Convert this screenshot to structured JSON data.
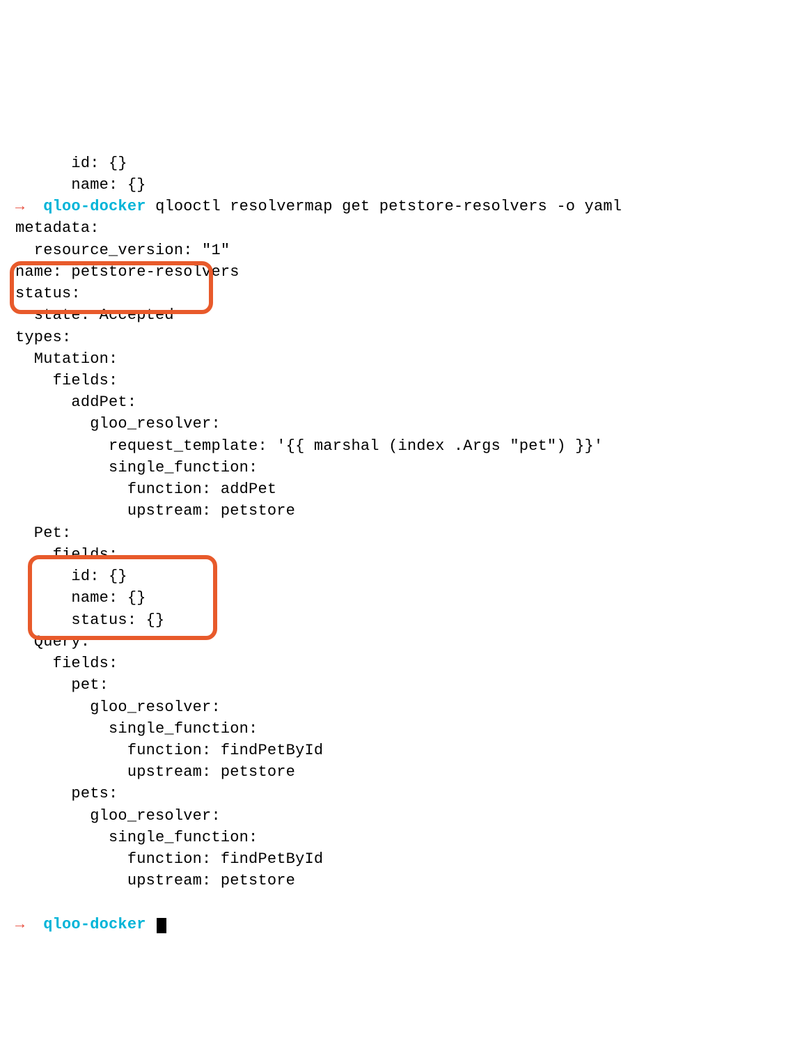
{
  "prompt": {
    "arrow": "→",
    "dir": "qloo-docker",
    "command": "qlooctl resolvermap get petstore-resolvers -o yaml"
  },
  "prompt2": {
    "arrow": "→",
    "dir": "qloo-docker"
  },
  "preamble": {
    "l1": "      id: {}",
    "l2": "      name: {}"
  },
  "output": {
    "l01": "metadata:",
    "l02": "  resource_version: \"1\"",
    "l03": "name: petstore-resolvers",
    "l04": "status:",
    "l05": "  state: Accepted",
    "l06": "types:",
    "l07": "  Mutation:",
    "l08": "    fields:",
    "l09": "      addPet:",
    "l10": "        gloo_resolver:",
    "l11": "          request_template: '{{ marshal (index .Args \"pet\") }}'",
    "l12": "          single_function:",
    "l13": "            function: addPet",
    "l14": "            upstream: petstore",
    "l15": "  Pet:",
    "l16": "    fields:",
    "l17": "      id: {}",
    "l18": "      name: {}",
    "l19": "      status: {}",
    "l20": "  Query:",
    "l21": "    fields:",
    "l22": "      pet:",
    "l23": "        gloo_resolver:",
    "l24": "          single_function:",
    "l25": "            function: findPetById",
    "l26": "            upstream: petstore",
    "l27": "      pets:",
    "l28": "        gloo_resolver:",
    "l29": "          single_function:",
    "l30": "            function: findPetById",
    "l31": "            upstream: petstore"
  }
}
